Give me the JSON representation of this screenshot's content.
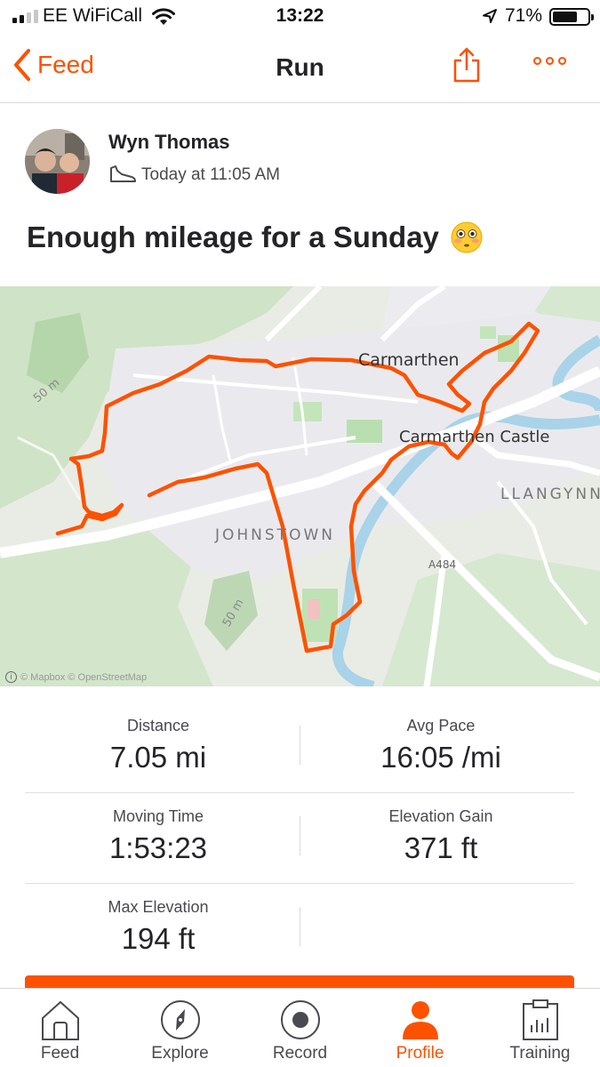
{
  "status_bar": {
    "carrier": "EE WiFiCall",
    "time": "13:22",
    "battery": "71%",
    "battery_level": 0.71
  },
  "nav": {
    "back_label": "Feed",
    "title": "Run"
  },
  "activity": {
    "athlete_name": "Wyn Thomas",
    "timestamp": "Today at 11:05 AM",
    "title": "Enough mileage for a Sunday",
    "title_emoji": "flushed-face-emoji"
  },
  "map": {
    "labels": {
      "carmarthen": "Carmarthen",
      "castle": "Carmarthen Castle",
      "llangynnor": "LLANGYNN",
      "johnstown": "JOHNSTOWN",
      "road": "A484",
      "contour_a": "50 m",
      "contour_b": "50 m"
    },
    "attribution": "© Mapbox © OpenStreetMap",
    "route_color": "#fc5200",
    "river_color": "#a9d3e9"
  },
  "stats": [
    {
      "label": "Distance",
      "value": "7.05 mi"
    },
    {
      "label": "Avg Pace",
      "value": "16:05 /mi"
    },
    {
      "label": "Moving Time",
      "value": "1:53:23"
    },
    {
      "label": "Elevation Gain",
      "value": "371 ft"
    },
    {
      "label": "Max Elevation",
      "value": "194 ft"
    }
  ],
  "tabs": [
    {
      "label": "Feed",
      "icon": "house-icon"
    },
    {
      "label": "Explore",
      "icon": "compass-icon"
    },
    {
      "label": "Record",
      "icon": "record-icon"
    },
    {
      "label": "Profile",
      "icon": "person-icon",
      "active": true
    },
    {
      "label": "Training",
      "icon": "clipboard-chart-icon"
    }
  ],
  "colors": {
    "accent": "#fc5200",
    "text": "#242428",
    "secondary_text": "#494950"
  }
}
